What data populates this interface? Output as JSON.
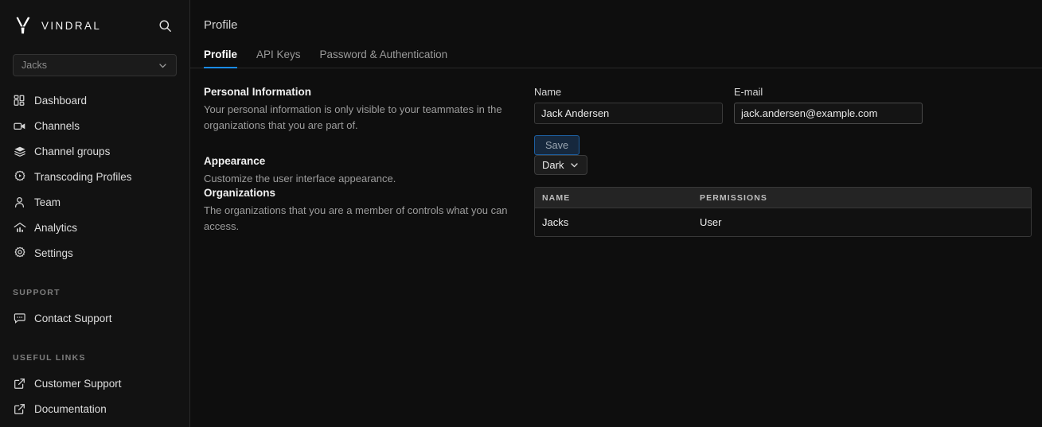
{
  "brand": {
    "name": "VINDRAL",
    "logo_icon": "vindral-v-logo",
    "search_icon": "search-icon"
  },
  "sidebar": {
    "org_switcher": {
      "value": "Jacks",
      "chevron_icon": "chevron-down-icon"
    },
    "nav": [
      {
        "label": "Dashboard",
        "icon": "dashboard-grid-icon"
      },
      {
        "label": "Channels",
        "icon": "video-camera-icon"
      },
      {
        "label": "Channel groups",
        "icon": "layers-stack-icon"
      },
      {
        "label": "Transcoding Profiles",
        "icon": "gear-play-icon"
      },
      {
        "label": "Team",
        "icon": "person-icon"
      },
      {
        "label": "Analytics",
        "icon": "bar-chart-icon"
      },
      {
        "label": "Settings",
        "icon": "gear-icon"
      }
    ],
    "support_section": {
      "title": "SUPPORT",
      "items": [
        {
          "label": "Contact Support",
          "icon": "chat-bubble-icon"
        }
      ]
    },
    "links_section": {
      "title": "USEFUL LINKS",
      "items": [
        {
          "label": "Customer Support",
          "icon": "external-link-icon"
        },
        {
          "label": "Documentation",
          "icon": "external-link-icon"
        }
      ]
    }
  },
  "header": {
    "title": "Profile"
  },
  "tabs": [
    {
      "label": "Profile",
      "active": true
    },
    {
      "label": "API Keys",
      "active": false
    },
    {
      "label": "Password & Authentication",
      "active": false
    }
  ],
  "sections": {
    "personal_information": {
      "title": "Personal Information",
      "description": "Your personal information is only visible to your teammates in the organizations that you are part of.",
      "name_field": {
        "label": "Name",
        "value": "Jack Andersen",
        "placeholder": "Name"
      },
      "email_field": {
        "label": "E-mail",
        "value": "jack.andersen@example.com",
        "placeholder": "E-mail"
      },
      "save_label": "Save"
    },
    "appearance": {
      "title": "Appearance",
      "description": "Customize the user interface appearance.",
      "theme_value": "Dark",
      "chevron_icon": "chevron-down-icon"
    },
    "organizations": {
      "title": "Organizations",
      "description": "The organizations that you are a member of controls what you can access.",
      "table": {
        "columns": [
          "NAME",
          "PERMISSIONS"
        ],
        "rows": [
          {
            "name": "Jacks",
            "permissions": "User"
          }
        ]
      }
    }
  },
  "colors": {
    "accent_blue": "#1a8cf0",
    "sidebar_bg": "#121212",
    "main_bg": "#0e0e0e",
    "table_header_bg": "#242424",
    "save_border": "#1d5fa0"
  }
}
